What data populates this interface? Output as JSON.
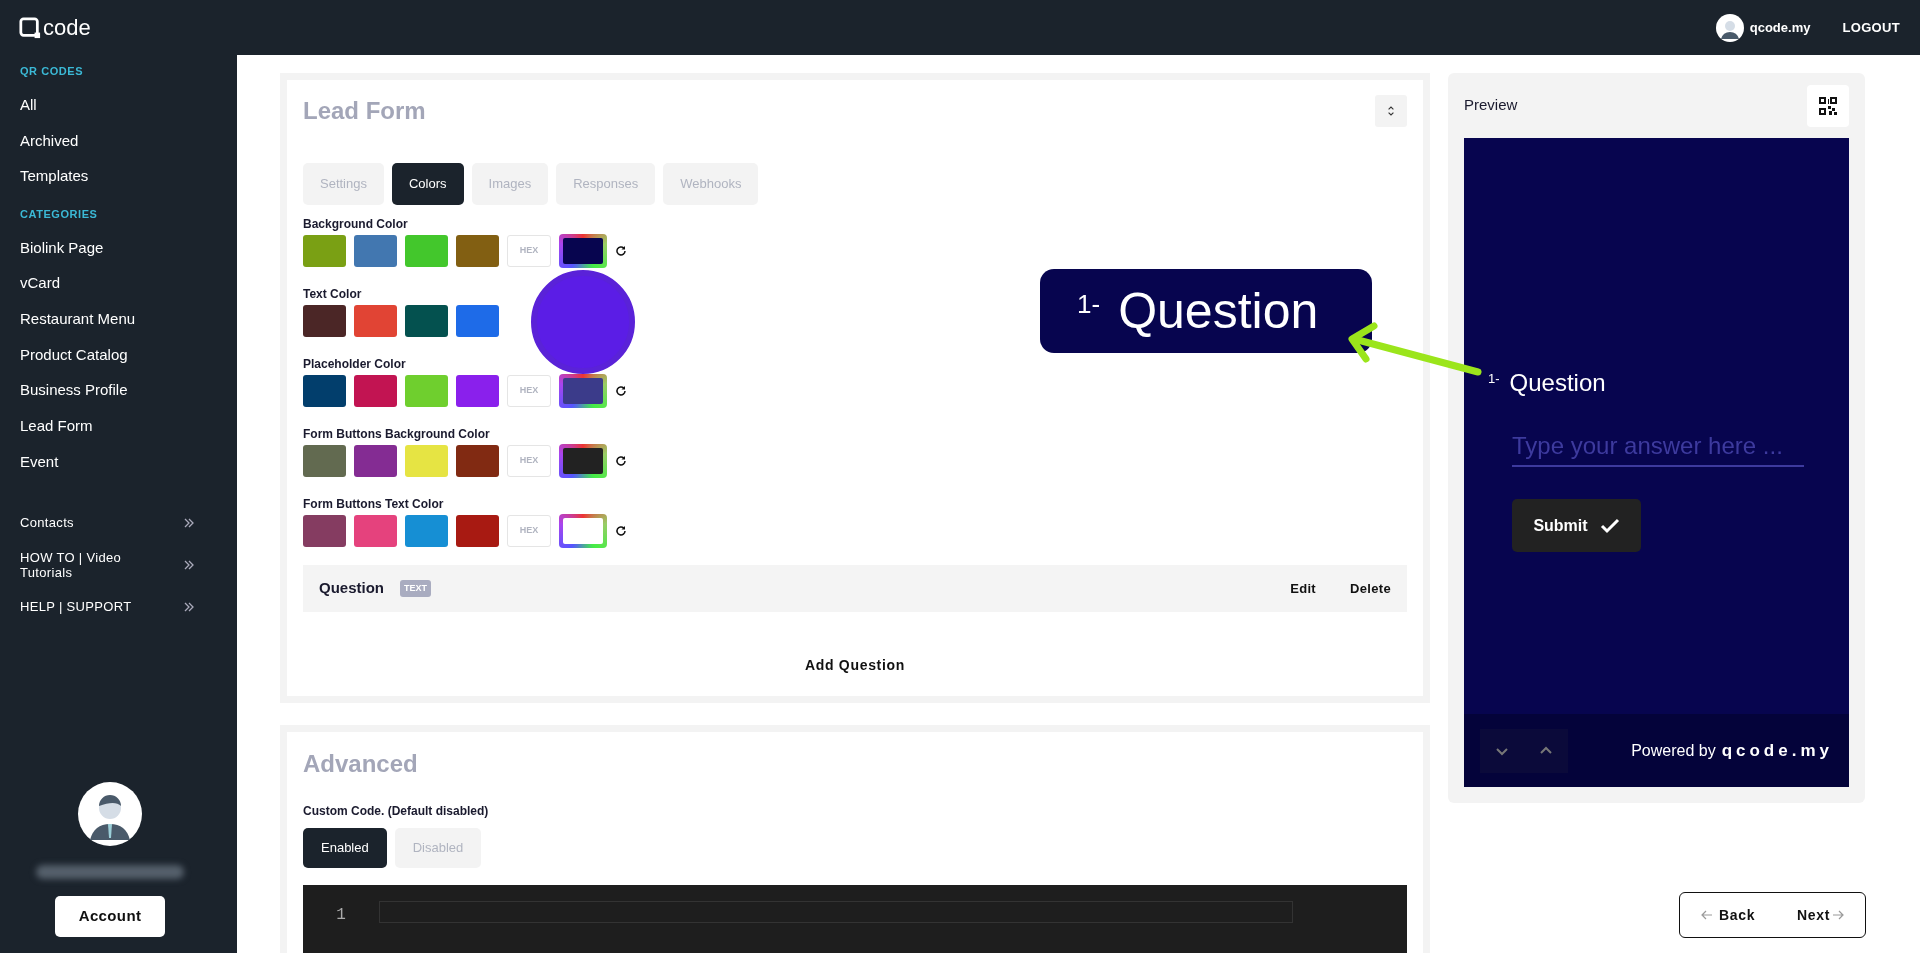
{
  "header": {
    "logo": "code",
    "user": "qcode.my",
    "logout": "LOGOUT"
  },
  "sidebar": {
    "sections": [
      {
        "heading": "QR CODES",
        "items": [
          "All",
          "Archived",
          "Templates"
        ]
      },
      {
        "heading": "CATEGORIES",
        "items": [
          "Biolink Page",
          "vCard",
          "Restaurant Menu",
          "Product Catalog",
          "Business Profile",
          "Lead Form",
          "Event"
        ]
      }
    ],
    "links": [
      "Contacts",
      "HOW TO | Video Tutorials",
      "HELP | SUPPORT"
    ],
    "account": "Account"
  },
  "lead_form": {
    "title": "Lead Form",
    "tabs": [
      {
        "label": "Settings",
        "selected": false
      },
      {
        "label": "Colors",
        "selected": true
      },
      {
        "label": "Images",
        "selected": false
      },
      {
        "label": "Responses",
        "selected": false
      },
      {
        "label": "Webhooks",
        "selected": false
      }
    ],
    "color_rows": [
      {
        "label": "Background Color",
        "swatches": [
          {
            "color": "#7aa014"
          },
          {
            "color": "#4277b0"
          },
          {
            "color": "#43c72c"
          },
          {
            "color": "#825f12"
          }
        ],
        "hex": "HEX",
        "picker": {
          "color": "#07054f"
        }
      },
      {
        "label": "Text Color",
        "swatches": [
          {
            "color": "#4b2626"
          },
          {
            "color": "#e14434"
          },
          {
            "color": "#04514f"
          },
          {
            "color": "#1e6be8"
          }
        ]
      },
      {
        "label": "Placeholder Color",
        "swatches": [
          {
            "color": "#023e6c"
          },
          {
            "color": "#c21452"
          },
          {
            "color": "#6fcf2e"
          },
          {
            "color": "#8a20ec"
          }
        ],
        "hex": "HEX",
        "picker": {
          "color": "#3b3b8a"
        }
      },
      {
        "label": "Form Buttons Background Color",
        "swatches": [
          {
            "color": "#626a50"
          },
          {
            "color": "#842c93"
          },
          {
            "color": "#e6e443"
          },
          {
            "color": "#812a12"
          }
        ],
        "hex": "HEX",
        "picker": {
          "color": "#222222"
        }
      },
      {
        "label": "Form Buttons Text Color",
        "swatches": [
          {
            "color": "#853c61"
          },
          {
            "color": "#e5427d"
          },
          {
            "color": "#168fd4"
          },
          {
            "color": "#a81a12"
          }
        ],
        "hex": "HEX",
        "picker": {
          "color": "#ffffff"
        }
      }
    ],
    "question": {
      "label": "Question",
      "type": "TEXT",
      "edit": "Edit",
      "delete": "Delete"
    },
    "add_question": "Add Question"
  },
  "advanced": {
    "title": "Advanced",
    "custom_code_label": "Custom Code. (Default disabled)",
    "options": [
      {
        "label": "Enabled",
        "selected": true
      },
      {
        "label": "Disabled",
        "selected": false
      }
    ],
    "line_numbers": [
      "1"
    ]
  },
  "callout": {
    "number": "1-",
    "text": "Question"
  },
  "preview": {
    "title": "Preview",
    "number": "1-",
    "question": "Question",
    "placeholder": "Type your answer here ...",
    "submit": "Submit",
    "powered_by": "Powered by",
    "brand": "qcode.my"
  },
  "nav": {
    "back": "Back",
    "next": "Next"
  }
}
